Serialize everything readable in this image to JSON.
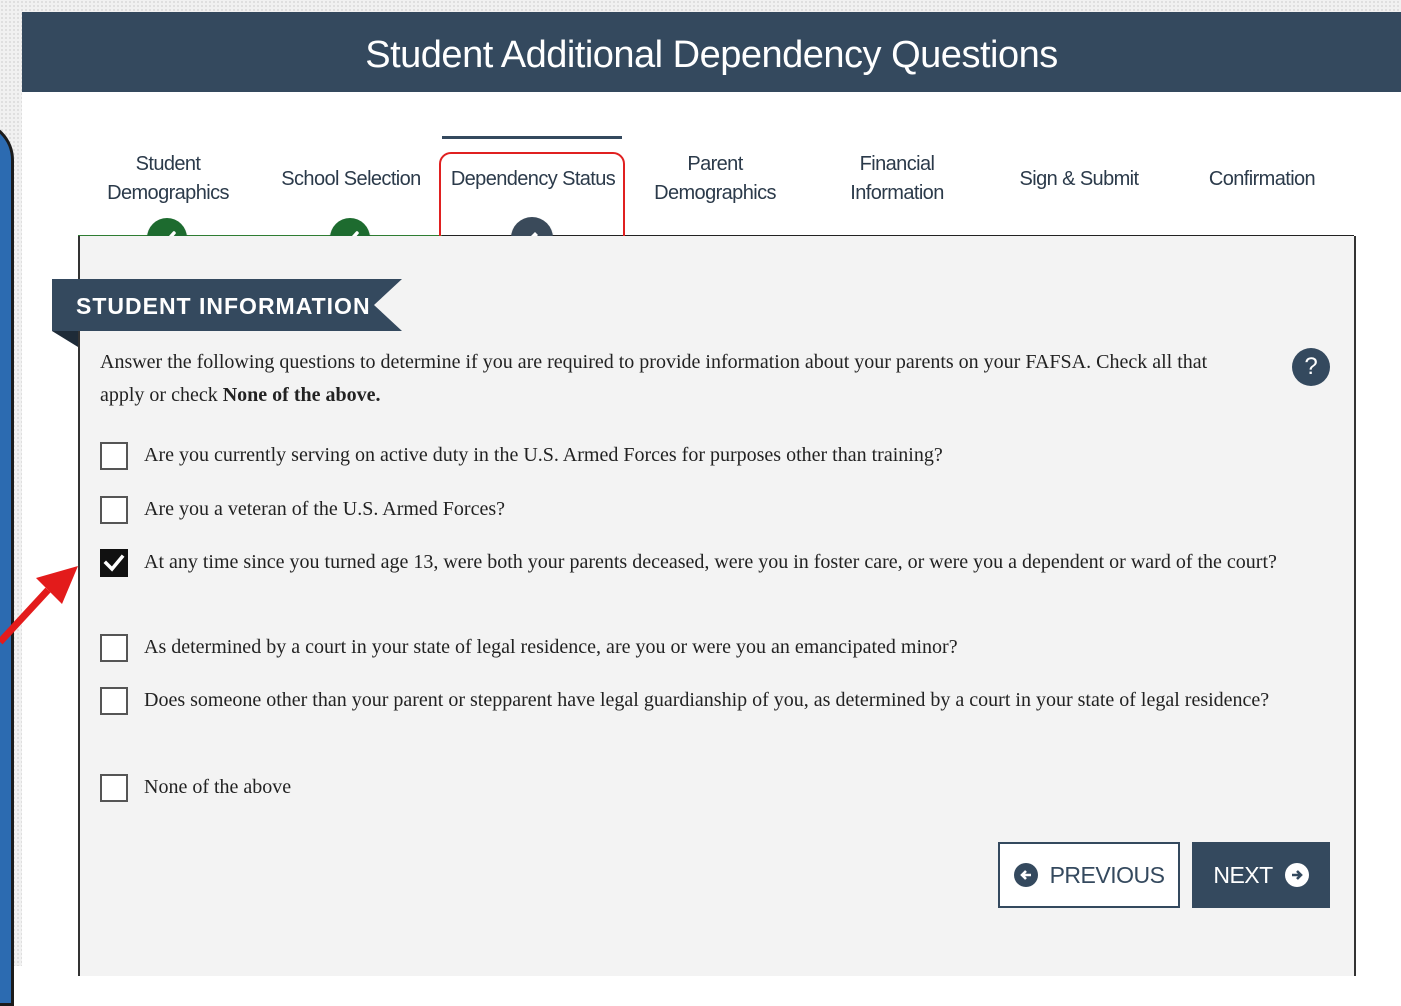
{
  "header": {
    "title": "Student Additional Dependency Questions"
  },
  "steps": [
    {
      "label": "Student\nDemographics",
      "status": "complete"
    },
    {
      "label": "School Selection",
      "status": "complete"
    },
    {
      "label": "Dependency Status",
      "status": "current"
    },
    {
      "label": "Parent\nDemographics",
      "status": "pending"
    },
    {
      "label": "Financial\nInformation",
      "status": "pending"
    },
    {
      "label": "Sign & Submit",
      "status": "pending"
    },
    {
      "label": "Confirmation",
      "status": "pending"
    }
  ],
  "section": {
    "title": "STUDENT INFORMATION"
  },
  "intro": {
    "text": "Answer the following questions to determine if you are required to provide information about your parents on your FAFSA. Check all that apply or check ",
    "bold": "None of the above."
  },
  "help": {
    "label": "?"
  },
  "options": [
    {
      "label": "Are you currently serving on active duty in the U.S. Armed Forces for purposes other than training?",
      "checked": false
    },
    {
      "label": "Are you a veteran of the U.S. Armed Forces?",
      "checked": false
    },
    {
      "label": "At any time since you turned age 13, were both your parents deceased, were you in foster care, or were you a dependent or ward of the court?",
      "checked": true
    },
    {
      "label": "As determined by a court in your state of legal residence, are you or were you an emancipated minor?",
      "checked": false
    },
    {
      "label": "Does someone other than your parent or stepparent have legal guardianship of you, as determined by a court in your state of legal residence?",
      "checked": false
    },
    {
      "label": "None of the above",
      "checked": false
    }
  ],
  "buttons": {
    "previous": "PREVIOUS",
    "next": "NEXT"
  },
  "colors": {
    "primary": "#34495e",
    "complete": "#1d6b2f",
    "highlight": "#e02020"
  }
}
